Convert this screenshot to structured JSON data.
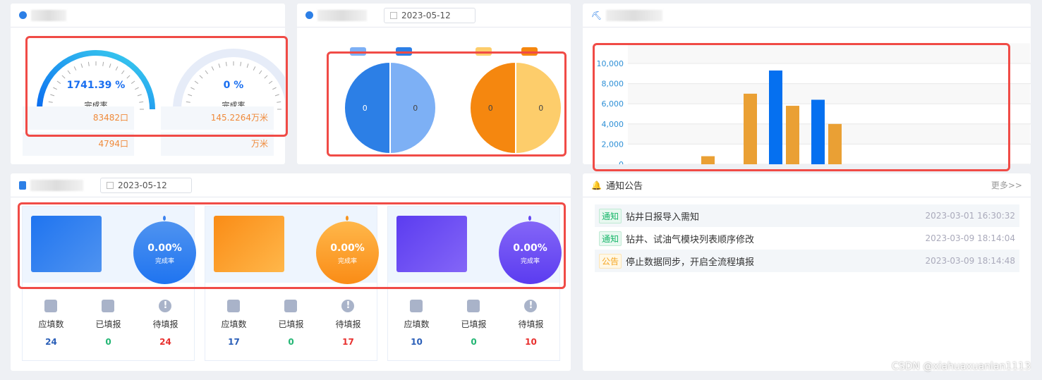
{
  "gauges": {
    "items": [
      {
        "percent_text": "1741.39 %",
        "label": "完成率",
        "value1": "83482口",
        "value2": "4794口",
        "progress": 100
      },
      {
        "percent_text": "0 %",
        "label": "完成率",
        "value1": "145.2264万米",
        "value2": "万米",
        "progress": 0
      }
    ]
  },
  "pies": {
    "date": "2023-05-12",
    "charts": [
      {
        "slices": [
          {
            "label": "0",
            "value": 1,
            "color": "#2c7fe6"
          },
          {
            "label": "0",
            "value": 1,
            "color": "#7db0f5"
          }
        ],
        "legend_colors": [
          "#7db0f5",
          "#2c7fe6"
        ]
      },
      {
        "slices": [
          {
            "label": "0",
            "value": 1,
            "color": "#f5870f"
          },
          {
            "label": "0",
            "value": 1,
            "color": "#fdcd6b"
          }
        ],
        "legend_colors": [
          "#fdcd6b",
          "#f5870f"
        ]
      }
    ]
  },
  "chart_data": {
    "type": "bar",
    "ylim": [
      0,
      10000
    ],
    "yticks": [
      "0",
      "2,000",
      "4,000",
      "6,000",
      "8,000",
      "10,000"
    ],
    "grid": true,
    "series": [
      {
        "color": "#0570f0",
        "values": [
          0,
          0,
          0,
          9300,
          6400,
          0,
          0,
          0,
          0,
          0
        ]
      },
      {
        "color": "#eaa034",
        "values": [
          0,
          800,
          7000,
          5800,
          4000,
          0,
          0,
          0,
          0,
          0
        ]
      }
    ]
  },
  "reports": {
    "date": "2023-05-12",
    "cards": [
      {
        "percent": "0.00%",
        "label": "完成率",
        "stats": [
          {
            "label": "应填数",
            "value": "24"
          },
          {
            "label": "已填报",
            "value": "0"
          },
          {
            "label": "待填报",
            "value": "24"
          }
        ]
      },
      {
        "percent": "0.00%",
        "label": "完成率",
        "stats": [
          {
            "label": "应填数",
            "value": "17"
          },
          {
            "label": "已填报",
            "value": "0"
          },
          {
            "label": "待填报",
            "value": "17"
          }
        ]
      },
      {
        "percent": "0.00%",
        "label": "完成率",
        "stats": [
          {
            "label": "应填数",
            "value": "10"
          },
          {
            "label": "已填报",
            "value": "0"
          },
          {
            "label": "待填报",
            "value": "10"
          }
        ]
      }
    ]
  },
  "notices": {
    "title": "通知公告",
    "more": "更多>>",
    "items": [
      {
        "tag": "通知",
        "title": "钻井日报导入需知",
        "time": "2023-03-01 16:30:32"
      },
      {
        "tag": "通知",
        "title": "钻井、试油气模块列表顺序修改",
        "time": "2023-03-09 18:14:04"
      },
      {
        "tag": "公告",
        "title": "停止数据同步，开启全流程填报",
        "time": "2023-03-09 18:14:48"
      }
    ]
  },
  "watermark": "CSDN @xiahuaxuanlan1113"
}
